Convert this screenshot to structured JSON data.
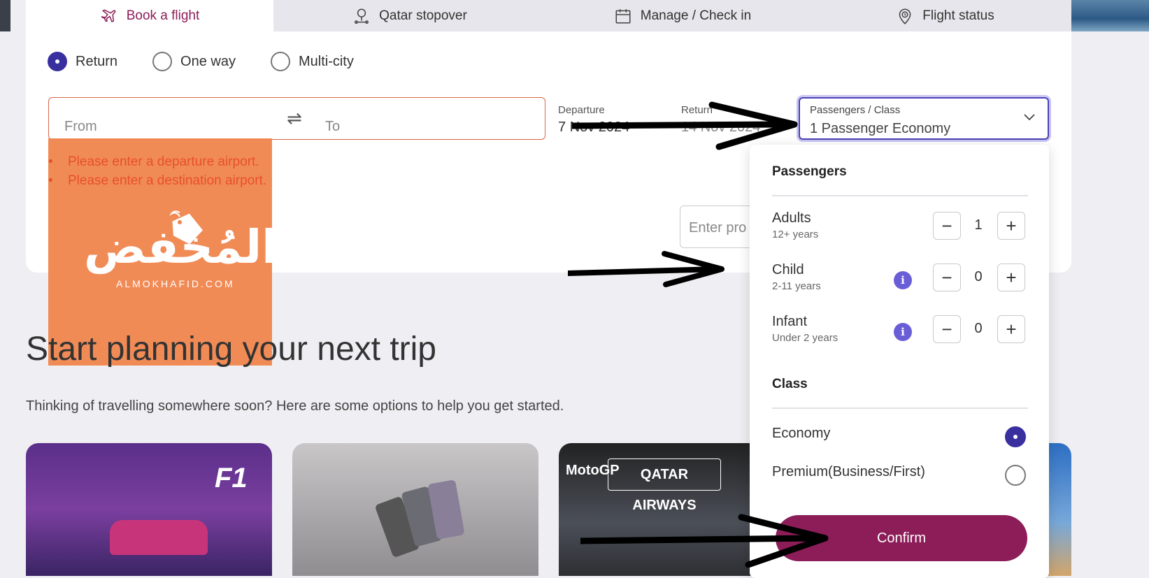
{
  "tabs": [
    {
      "label": "Book a flight",
      "icon": "plane-icon",
      "active": true
    },
    {
      "label": "Qatar stopover",
      "icon": "stopover-pin-icon"
    },
    {
      "label": "Manage / Check in",
      "icon": "calendar-icon"
    },
    {
      "label": "Flight status",
      "icon": "location-clock-icon"
    }
  ],
  "trip_types": [
    {
      "label": "Return",
      "selected": true
    },
    {
      "label": "One way",
      "selected": false
    },
    {
      "label": "Multi-city",
      "selected": false
    }
  ],
  "search": {
    "from_placeholder": "From",
    "to_placeholder": "To",
    "departure_label": "Departure",
    "departure_value": "7 Nov 2024",
    "return_label": "Return",
    "return_value": "14 Nov 2024",
    "pax_label": "Passengers / Class",
    "pax_value": "1  Passenger Economy",
    "promo_placeholder": "Enter pro"
  },
  "errors": [
    "Please enter a departure airport.",
    "Please enter a destination airport."
  ],
  "watermark": {
    "arabic": "المُخفض",
    "latin": "ALMOKHAFID.COM"
  },
  "passengers": {
    "title": "Passengers",
    "rows": [
      {
        "label": "Adults",
        "sub": "12+ years",
        "count": "1",
        "info": false
      },
      {
        "label": "Child",
        "sub": "2-11 years",
        "count": "0",
        "info": true
      },
      {
        "label": "Infant",
        "sub": "Under 2 years",
        "count": "0",
        "info": true
      }
    ],
    "minus": "−",
    "plus": "+",
    "info_glyph": "i"
  },
  "class_section": {
    "title": "Class",
    "options": [
      {
        "label": "Economy",
        "selected": true
      },
      {
        "label": "Premium(Business/First)",
        "selected": false
      }
    ]
  },
  "confirm_label": "Confirm",
  "planning": {
    "heading": "Start planning your next trip",
    "subheading": "Thinking of travelling somewhere soon? Here are some options to help you get started."
  },
  "tiles": {
    "f1_logo": "F1",
    "motogp": "MotoGP",
    "qatar_airways": "QATAR AIRWAYS"
  },
  "colors": {
    "brand": "#8c1d58",
    "accent": "#3a2f9f",
    "error": "#e8502a",
    "watermark_bg": "#f0864f"
  }
}
